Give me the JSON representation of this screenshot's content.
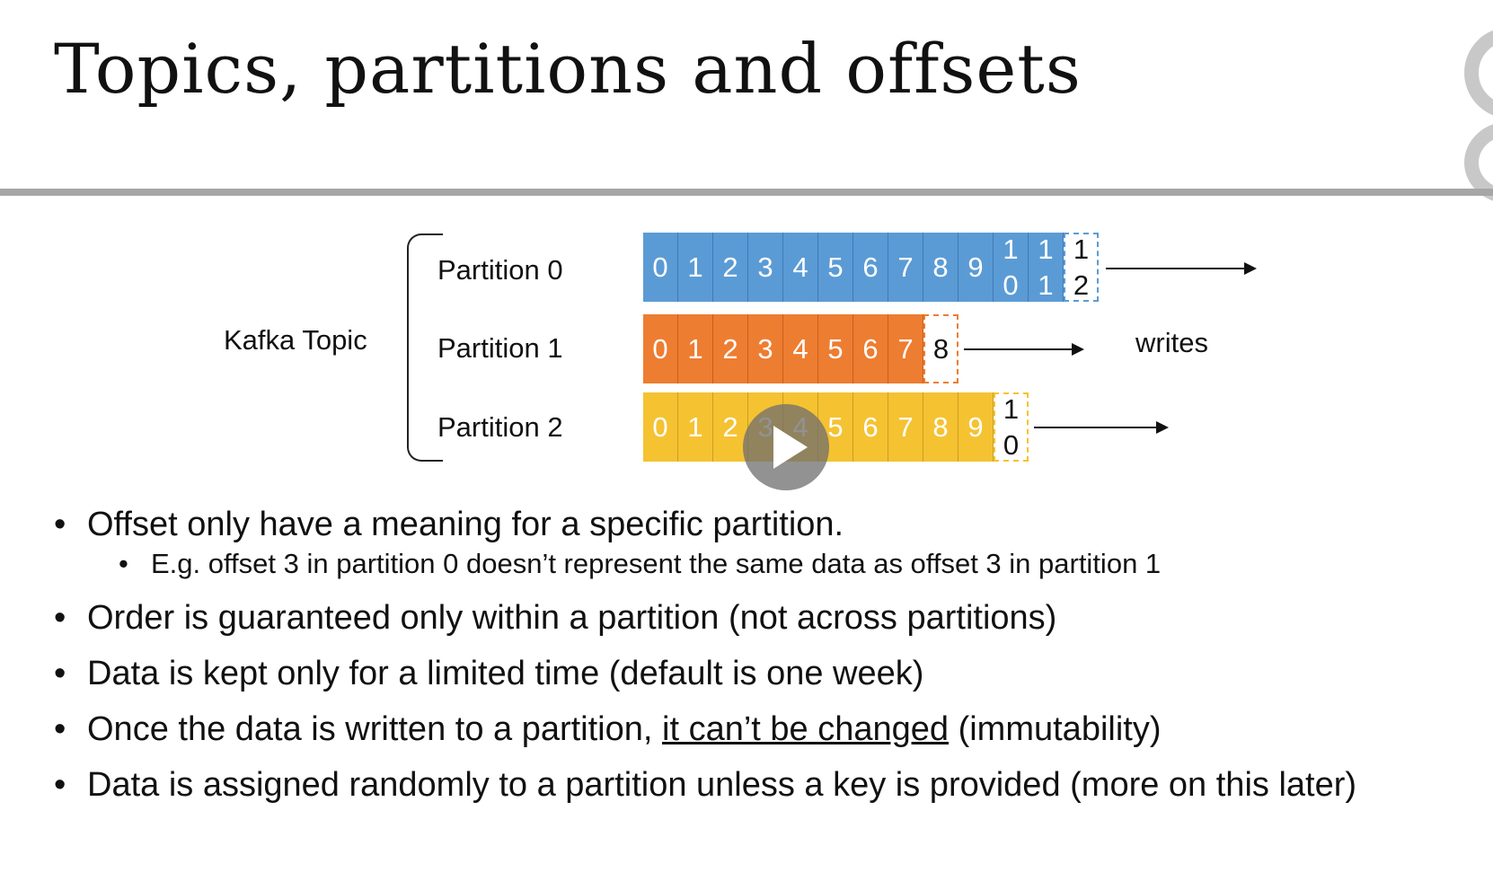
{
  "slide": {
    "title": "Topics, partitions and offsets"
  },
  "diagram": {
    "topic_label": "Kafka Topic",
    "writes_label": "writes",
    "partitions": [
      {
        "label": "Partition 0",
        "color": "#5b9bd5",
        "offsets": [
          "0",
          "1",
          "2",
          "3",
          "4",
          "5",
          "6",
          "7",
          "8",
          "9",
          "1\n0",
          "1\n1"
        ],
        "next_offset": "1\n2"
      },
      {
        "label": "Partition 1",
        "color": "#ed7d31",
        "offsets": [
          "0",
          "1",
          "2",
          "3",
          "4",
          "5",
          "6",
          "7"
        ],
        "next_offset": "8"
      },
      {
        "label": "Partition 2",
        "color": "#f5c232",
        "offsets": [
          "0",
          "1",
          "2",
          "3",
          "4",
          "5",
          "6",
          "7",
          "8",
          "9"
        ],
        "next_offset": "1\n0"
      }
    ]
  },
  "bullets": [
    "Offset only have a meaning for a specific partition.",
    "E.g. offset 3 in partition 0 doesn’t represent the same data as offset 3 in partition 1",
    "Order is guaranteed only within a partition (not across partitions)",
    "Data is kept only for a limited time (default is one week)",
    "Once the data is written to a partition,",
    "it can’t be changed",
    " (immutability)",
    "Data is assigned randomly to a partition unless a key is provided (more on this later)"
  ],
  "player": {
    "icon": "play-icon"
  }
}
